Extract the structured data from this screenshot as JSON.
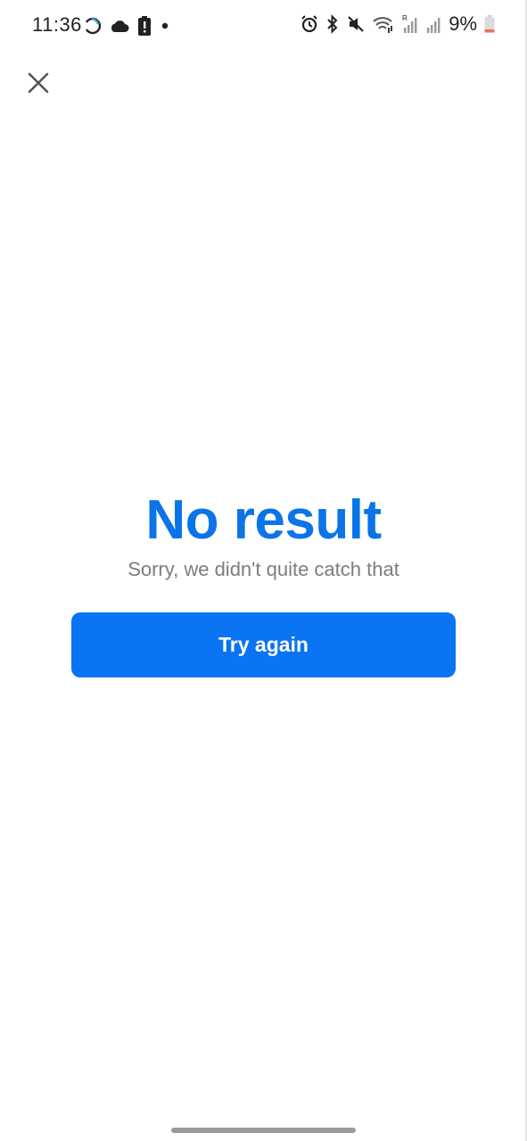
{
  "status_bar": {
    "time": "11:36",
    "battery_percent": "9%",
    "battery_level": 0.09,
    "left_icons": [
      "sync-icon",
      "cloud-icon",
      "alert-battery-icon",
      "dot-icon"
    ],
    "right_icons": [
      "alarm-icon",
      "bluetooth-icon",
      "mute-icon",
      "wifi-icon",
      "signal-icon",
      "signal-icon-2",
      "battery-icon"
    ]
  },
  "header": {
    "close_icon": "close-icon"
  },
  "main": {
    "title": "No result",
    "subtitle": "Sorry, we didn't quite catch that",
    "button_label": "Try again"
  },
  "colors": {
    "accent": "#0a74f2",
    "title": "#0a74e8",
    "subtitle": "#7d7d7d",
    "background": "#ffffff"
  }
}
